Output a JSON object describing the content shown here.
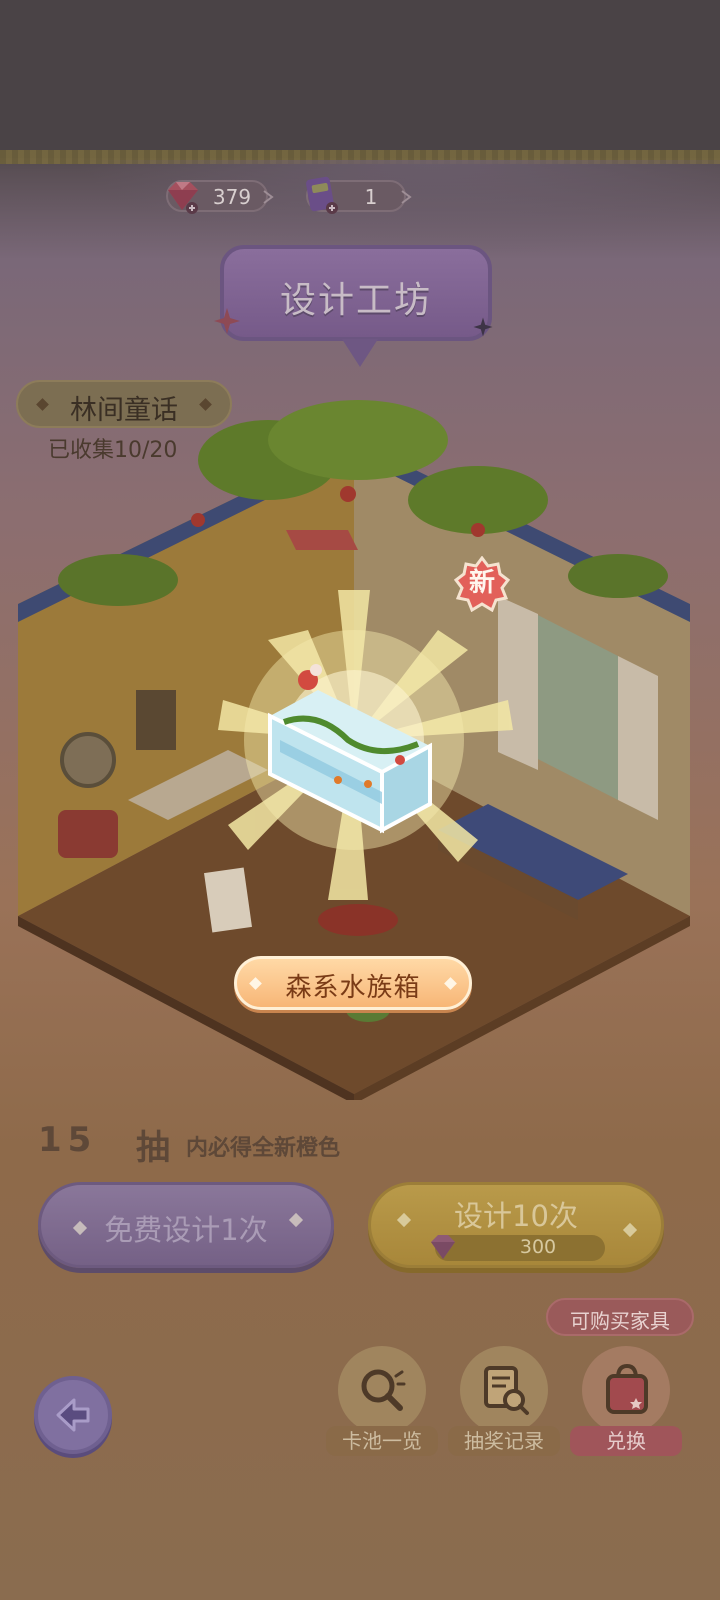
{
  "currency": {
    "gems": "379",
    "tickets": "1"
  },
  "title": "设计工坊",
  "collection": {
    "name": "林间童话",
    "progress": "已收集10/20"
  },
  "reveal": {
    "new_badge": "新",
    "item_name": "森系水族箱"
  },
  "guarantee": {
    "num_a": "15",
    "num_b": "抽",
    "text": "内必得全新橙色"
  },
  "actions": {
    "free_label": "免费设计1次",
    "ten_label": "设计10次",
    "ten_cost": "300"
  },
  "buy_tag": "可购买家具",
  "bottom": {
    "pool_label": "卡池一览",
    "record_label": "抽奖记录",
    "exchange_label": "兑换"
  },
  "colors": {
    "accent_orange": "#f7b677",
    "purple_button": "#756186",
    "gold_button": "#a8873a"
  },
  "icons": [
    "gem-icon",
    "ticket-icon",
    "back-arrow-icon",
    "search-icon",
    "record-icon",
    "shopping-bag-icon"
  ]
}
